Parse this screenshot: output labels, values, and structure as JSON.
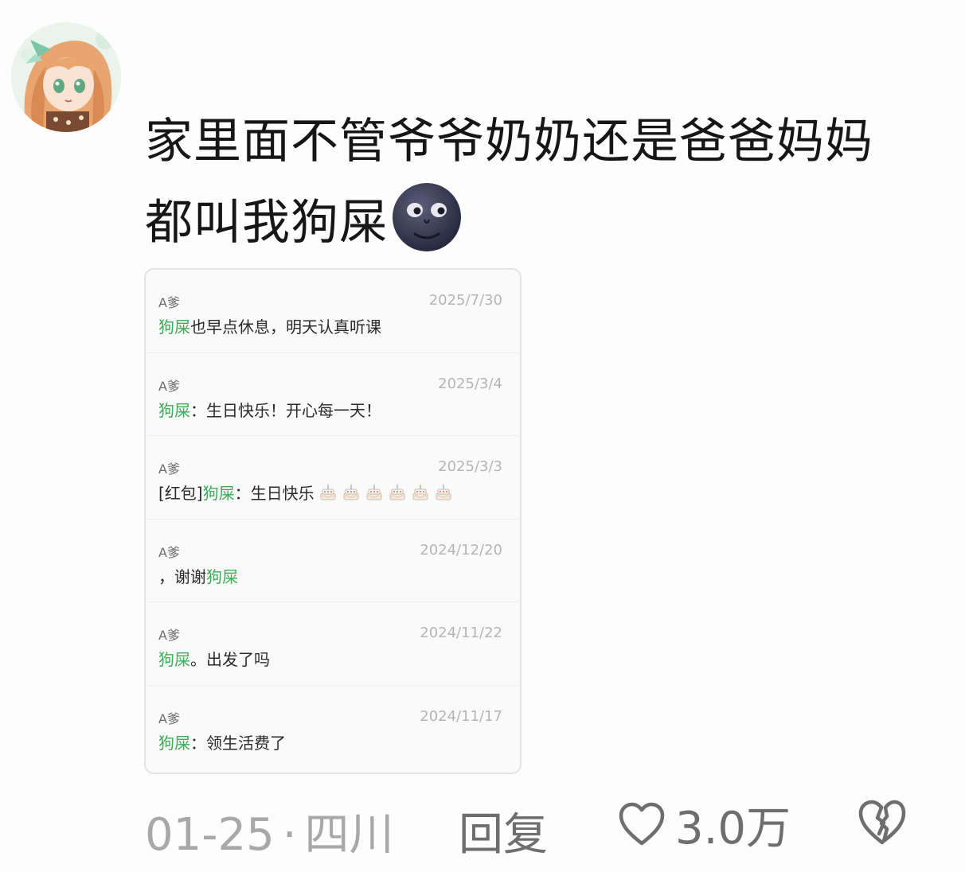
{
  "comment": {
    "avatar_icon": "anime-girl-avatar",
    "text": "家里面不管爷爷奶奶还是爸爸妈妈都叫我狗屎",
    "emoji_icon": "new-moon-face-emoji"
  },
  "chat_screenshot": {
    "highlight_color": "#3faa58",
    "messages": [
      {
        "sender": "A爹",
        "date": "2025/7/30",
        "prefix": "",
        "highlight": "狗屎",
        "suffix": "也早点休息，明天认真听课",
        "cakes": 0
      },
      {
        "sender": "A爹",
        "date": "2025/3/4",
        "prefix": "",
        "highlight": "狗屎",
        "suffix": "：生日快乐！开心每一天！",
        "cakes": 0
      },
      {
        "sender": "A爹",
        "date": "2025/3/3",
        "prefix": "[红包]",
        "highlight": "狗屎",
        "suffix": "：生日快乐",
        "cakes": 6
      },
      {
        "sender": "A爹",
        "date": "2024/12/20",
        "prefix": "，谢谢",
        "highlight": "狗屎",
        "suffix": "",
        "cakes": 0
      },
      {
        "sender": "A爹",
        "date": "2024/11/22",
        "prefix": "",
        "highlight": "狗屎",
        "suffix": "。出发了吗",
        "cakes": 0
      },
      {
        "sender": "A爹",
        "date": "2024/11/17",
        "prefix": "",
        "highlight": "狗屎",
        "suffix": "：领生活费了",
        "cakes": 0
      }
    ]
  },
  "footer": {
    "date": "01-25",
    "separator": "·",
    "location": "四川",
    "reply_label": "回复",
    "like_icon": "heart-outline-icon",
    "like_count": "3.0万",
    "dislike_icon": "broken-heart-icon"
  }
}
